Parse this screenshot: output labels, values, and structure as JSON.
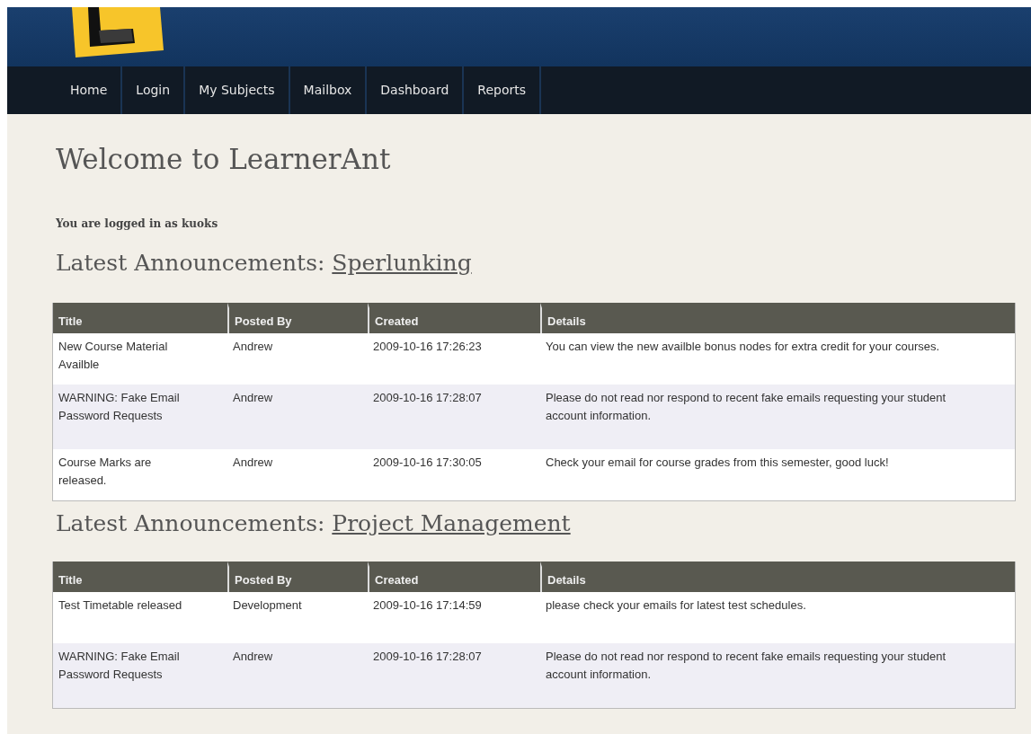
{
  "nav": [
    {
      "label": "Home"
    },
    {
      "label": "Login"
    },
    {
      "label": "My Subjects"
    },
    {
      "label": "Mailbox"
    },
    {
      "label": "Dashboard"
    },
    {
      "label": "Reports"
    }
  ],
  "welcome": "Welcome to LearnerAnt",
  "login_status": "You are logged in as kuoks",
  "sections": [
    {
      "heading": "Latest Announcements: ",
      "subject": "Sperlunking",
      "columns": [
        "Title",
        "Posted By",
        "Created",
        "Details"
      ],
      "rows": [
        {
          "title": "New Course Material Availble",
          "posted_by": "Andrew",
          "created": "2009-10-16 17:26:23",
          "details": "You can view the new availble bonus nodes for extra credit for your courses."
        },
        {
          "title": "WARNING: Fake Email Password Requests",
          "posted_by": "Andrew",
          "created": "2009-10-16 17:28:07",
          "details": "Please do not read nor respond to recent fake emails requesting your student account information."
        },
        {
          "title": "Course Marks are released.",
          "posted_by": "Andrew",
          "created": "2009-10-16 17:30:05",
          "details": "Check your email for course grades from this semester, good luck!"
        }
      ]
    },
    {
      "heading": "Latest Announcements: ",
      "subject": "Project Management",
      "columns": [
        "Title",
        "Posted By",
        "Created",
        "Details"
      ],
      "rows": [
        {
          "title": "Test Timetable released",
          "posted_by": "Development",
          "created": "2009-10-16 17:14:59",
          "details": "please check your emails for latest test schedules."
        },
        {
          "title": "WARNING: Fake Email Password Requests",
          "posted_by": "Andrew",
          "created": "2009-10-16 17:28:07",
          "details": "Please do not read nor respond to recent fake emails requesting your student account information."
        }
      ]
    }
  ]
}
